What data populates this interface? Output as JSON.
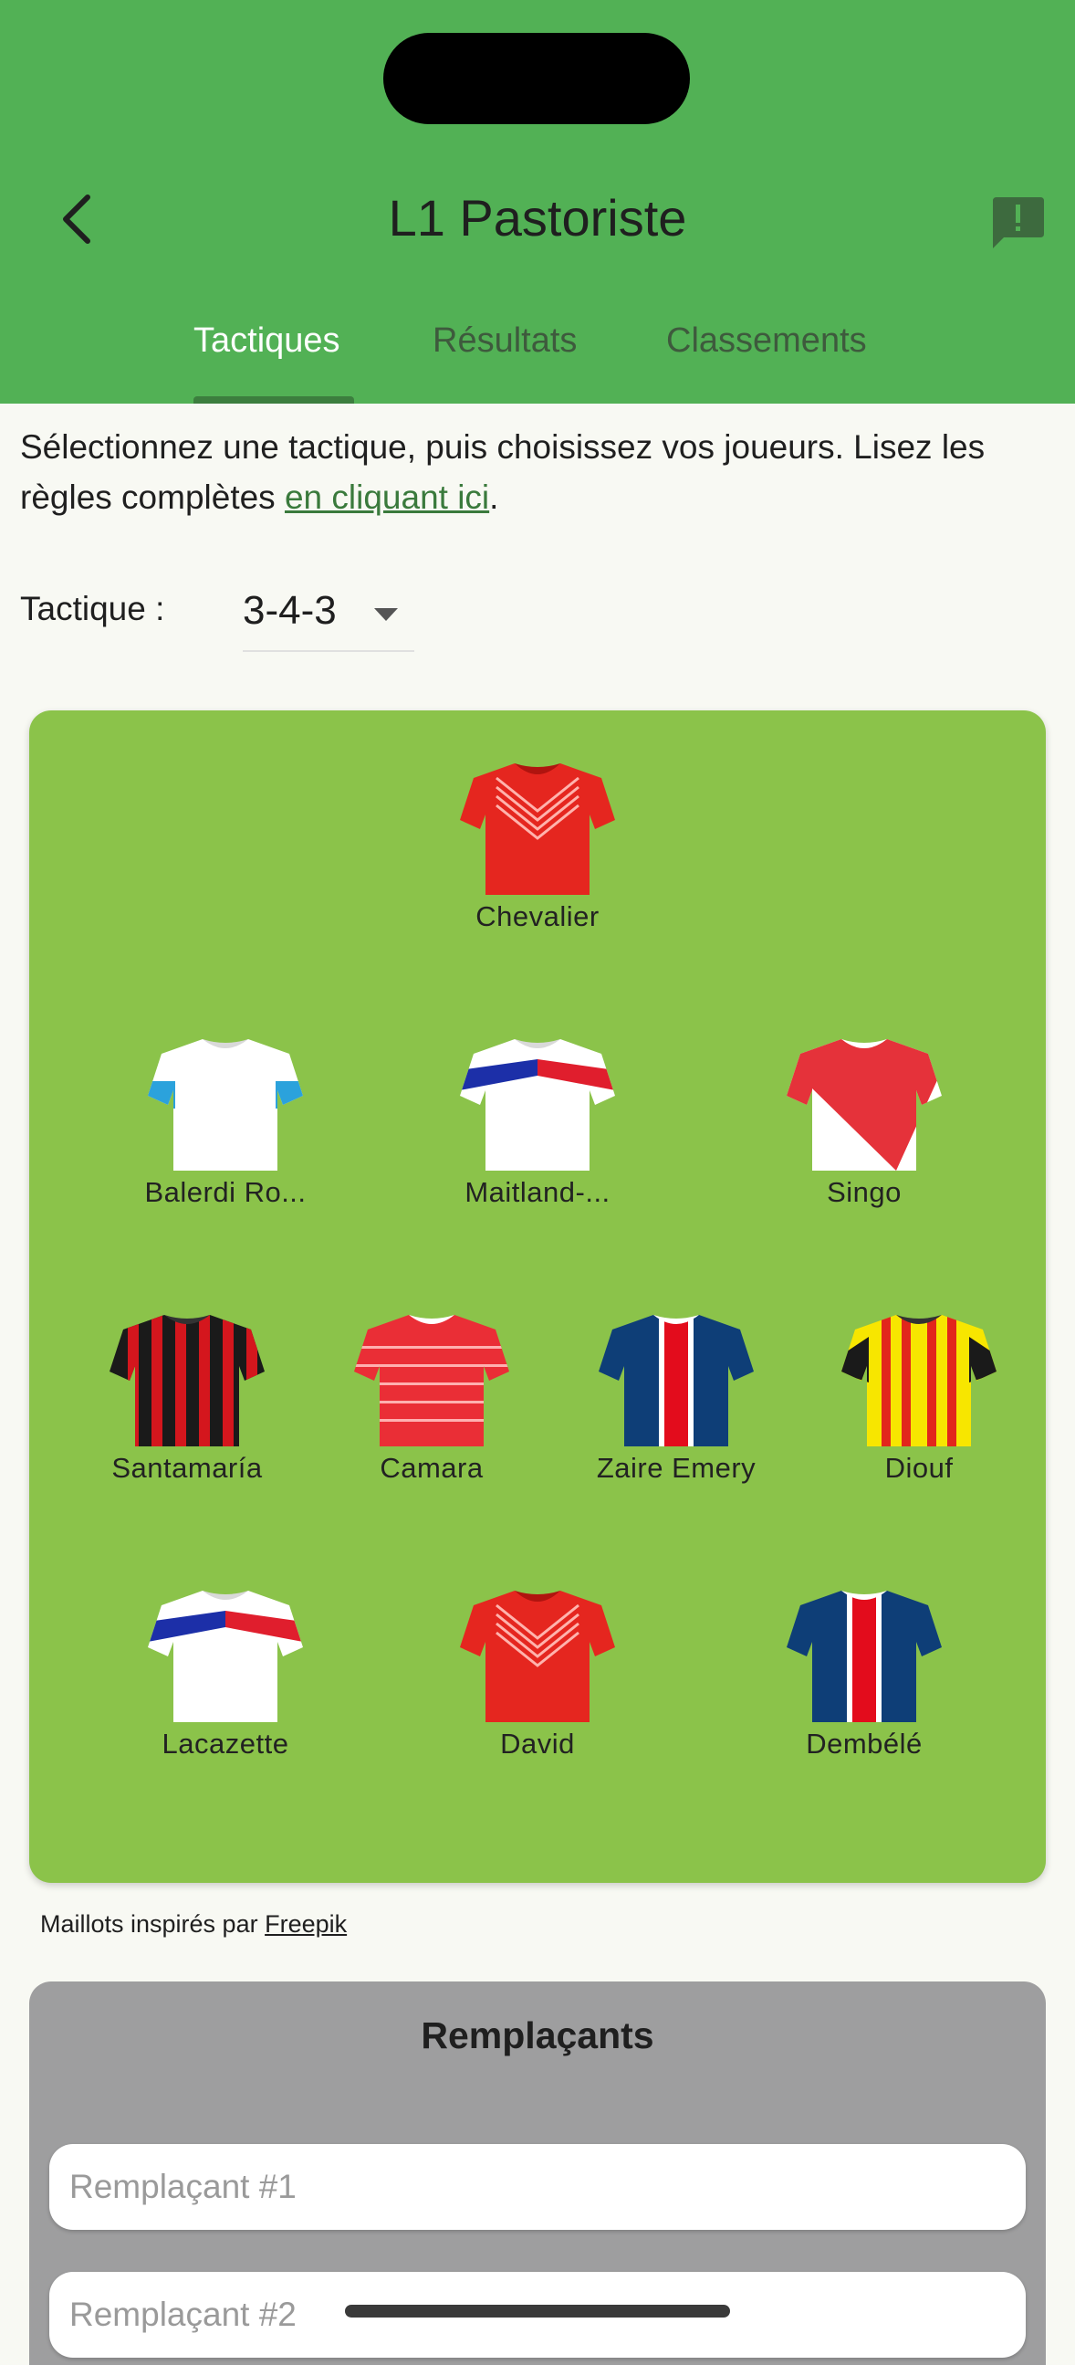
{
  "header": {
    "title": "L1 Pastoriste",
    "report_icon": "report-icon",
    "back_icon": "back-arrow-icon"
  },
  "tabs": [
    {
      "label": "Tactiques",
      "active": true
    },
    {
      "label": "Résultats",
      "active": false
    },
    {
      "label": "Classements",
      "active": false
    }
  ],
  "intro": {
    "text": "Sélectionnez une tactique, puis choisissez vos joueurs. Lisez les règles complètes ",
    "link": "en cliquant ici",
    "suffix": "."
  },
  "tactic": {
    "label": "Tactique :",
    "value": "3-4-3"
  },
  "players": {
    "goalkeeper": "Chevalier",
    "defenders": [
      "Balerdi Ro...",
      "Maitland-...",
      "Singo"
    ],
    "midfielders": [
      "Santamaría",
      "Camara",
      "Zaire Emery",
      "Diouf"
    ],
    "forwards": [
      "Lacazette",
      "David",
      "Dembélé"
    ]
  },
  "credit": {
    "text": "Maillots inspirés par ",
    "link": "Freepik"
  },
  "substitutes": {
    "title": "Remplaçants",
    "placeholders": [
      "Remplaçant #1",
      "Remplaçant #2"
    ]
  },
  "colors": {
    "appbar": "#52b155",
    "field": "#8bc34a",
    "subs_panel": "#9e9e9f",
    "link": "#3a7a3c"
  }
}
